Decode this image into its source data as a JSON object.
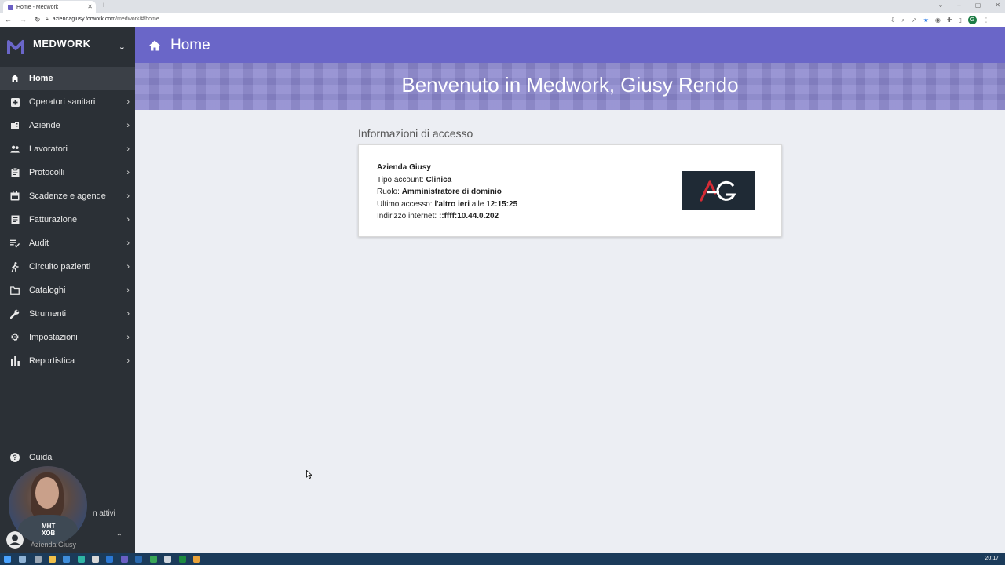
{
  "browser": {
    "tab_title": "Home - Medwork",
    "url_host": "aziendagiusy.forwork.com",
    "url_path": "/medwork/#/home",
    "profile_initial": "G"
  },
  "sidebar": {
    "brand": "MEDWORK",
    "items": [
      {
        "label": "Home",
        "icon": "home-icon",
        "active": true
      },
      {
        "label": "Operatori sanitari",
        "icon": "plus-square-icon"
      },
      {
        "label": "Aziende",
        "icon": "building-icon"
      },
      {
        "label": "Lavoratori",
        "icon": "users-icon"
      },
      {
        "label": "Protocolli",
        "icon": "clipboard-icon"
      },
      {
        "label": "Scadenze e agende",
        "icon": "calendar-icon"
      },
      {
        "label": "Fatturazione",
        "icon": "invoice-icon"
      },
      {
        "label": "Audit",
        "icon": "checklist-icon"
      },
      {
        "label": "Circuito pazienti",
        "icon": "walking-icon"
      },
      {
        "label": "Cataloghi",
        "icon": "folder-icon"
      },
      {
        "label": "Strumenti",
        "icon": "wrench-icon"
      },
      {
        "label": "Impostazioni",
        "icon": "gear-icon"
      },
      {
        "label": "Reportistica",
        "icon": "bar-chart-icon"
      }
    ],
    "guida": "Guida",
    "sessions_label": "n attivi",
    "user_name": "Azienda Giusy"
  },
  "header": {
    "title": "Home"
  },
  "hero": {
    "welcome": "Benvenuto in Medwork, Giusy Rendo"
  },
  "access_info": {
    "section_title": "Informazioni di accesso",
    "company": "Azienda Giusy",
    "account_type_label": "Tipo account:",
    "account_type": "Clinica",
    "role_label": "Ruolo:",
    "role": "Amministratore di dominio",
    "last_access_label": "Ultimo accesso:",
    "last_access_day": "l'altro ieri",
    "last_access_at": "alle",
    "last_access_time": "12:15:25",
    "ip_label": "Indirizzo internet:",
    "ip": "::ffff:10.44.0.202",
    "logo_text": "AG"
  },
  "taskbar": {
    "clock": "20:17"
  },
  "colors": {
    "accent": "#6a66c8",
    "sidebar_bg": "#2b3036",
    "page_bg": "#eceef3"
  }
}
